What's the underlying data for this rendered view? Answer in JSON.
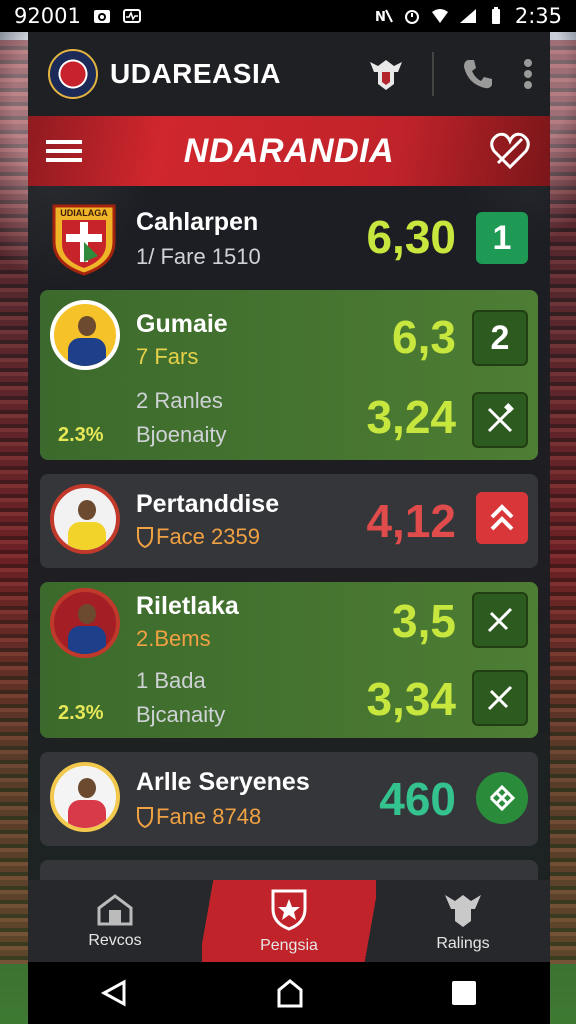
{
  "status_bar": {
    "left_text": "92001",
    "time": "2:35"
  },
  "header": {
    "app_title": "UDAREASIA"
  },
  "banner": {
    "title": "NDARANDIA"
  },
  "rows": [
    {
      "name": "Cahlarpen",
      "sub": "1/ Fare 1510",
      "odds": "6,30",
      "badge": "1",
      "crest_text": "UDIALAGA"
    },
    {
      "name": "Gumaie",
      "sub": "7 Fars",
      "odds": "6,3",
      "badge": "2",
      "sub2": "2 Ranles",
      "sub3": "Bjoenaity",
      "pct": "2.3%",
      "odds2": "3,24"
    },
    {
      "name": "Pertanddise",
      "sub": "Face 2359",
      "odds": "4,12"
    },
    {
      "name": "Riletlaka",
      "sub": "2.Bems",
      "odds": "3,5",
      "sub2": "1 Bada",
      "sub3": "Bjcanaity",
      "pct": "2.3%",
      "odds2": "3,34"
    },
    {
      "name": "Arlle Seryenes",
      "sub": "Fane 8748",
      "odds": "460"
    }
  ],
  "bottom_nav": {
    "items": [
      "Revcos",
      "Pengsia",
      "Ralings"
    ],
    "active_index": 1
  },
  "colors": {
    "accent_red": "#c1232a",
    "lime_odds": "#c7e63e",
    "red_odds": "#e04b4b",
    "teal_odds": "#34c38f"
  }
}
